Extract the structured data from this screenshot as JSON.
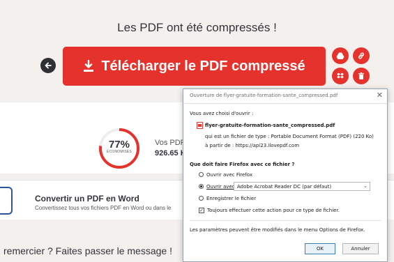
{
  "header": {
    "title": "Les PDF ont été compressés !"
  },
  "download": {
    "label": "Télécharger le PDF compressé"
  },
  "stats": {
    "percent": "77%",
    "percent_caption": "ÉCONOMISÉS",
    "vos_label": "Vos PDF",
    "size": "926.65 K"
  },
  "convert": {
    "title": "Convertir un PDF en Word",
    "subtitle": "Convertissez tous vos fichiers PDF en Word ou dans le"
  },
  "share": {
    "text": "remercier ? Faites passer le message !"
  },
  "dialog": {
    "title": "Ouverture de flyer-gratuite-formation-sante_compressed.pdf",
    "chosen_label": "Vous avez choisi d'ouvrir :",
    "filename": "flyer-gratuite-formation-sante_compressed.pdf",
    "type_line": "qui est un fichier de type :  Portable Document Format (PDF) (220 Ko)",
    "from_line": "à partir de :  https://api23.ilovepdf.com",
    "question": "Que doit faire Firefox avec ce fichier ?",
    "open_with_firefox": "Ouvrir avec Firefox",
    "open_with": "Ouvrir avec",
    "app_selected": "Adobe Acrobat Reader DC (par défaut)",
    "save_file": "Enregistrer le fichier",
    "always_do": "Toujours effectuer cette action pour ce type de fichier.",
    "footer_note": "Les paramètres peuvent être modifiés dans le menu Options de Firefox.",
    "ok_label": "OK",
    "cancel_label": "Annuler"
  },
  "colors": {
    "accent": "#e5322d",
    "ring_track": "#eeeeee"
  }
}
